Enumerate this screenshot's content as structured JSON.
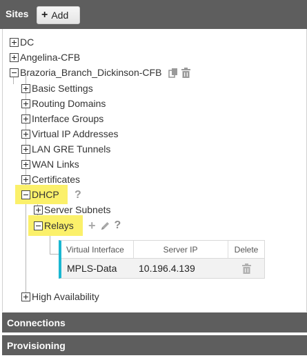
{
  "header": {
    "title": "Sites",
    "add_label": "Add"
  },
  "tree": {
    "sites": [
      {
        "label": "DC"
      },
      {
        "label": "Angelina-CFB"
      },
      {
        "label": "Brazoria_Branch_Dickinson-CFB"
      }
    ],
    "branch_children": [
      {
        "label": "Basic Settings"
      },
      {
        "label": "Routing Domains"
      },
      {
        "label": "Interface Groups"
      },
      {
        "label": "Virtual IP Addresses"
      },
      {
        "label": "LAN GRE Tunnels"
      },
      {
        "label": "WAN Links"
      },
      {
        "label": "Certificates"
      },
      {
        "label": "DHCP"
      }
    ],
    "dhcp_children": [
      {
        "label": "Server Subnets"
      },
      {
        "label": "Relays"
      }
    ],
    "high_availability": "High Availability",
    "help_glyph": "?"
  },
  "relays_table": {
    "columns": [
      "Virtual Interface",
      "Server IP",
      "Delete"
    ],
    "rows": [
      {
        "virtual_interface": "MPLS-Data",
        "server_ip": "10.196.4.139"
      }
    ]
  },
  "footer": {
    "connections": "Connections",
    "provisioning": "Provisioning"
  },
  "colors": {
    "header_bg": "#5e5e5e",
    "highlight": "#fbf06a",
    "table_accent": "#1ab7d1"
  }
}
